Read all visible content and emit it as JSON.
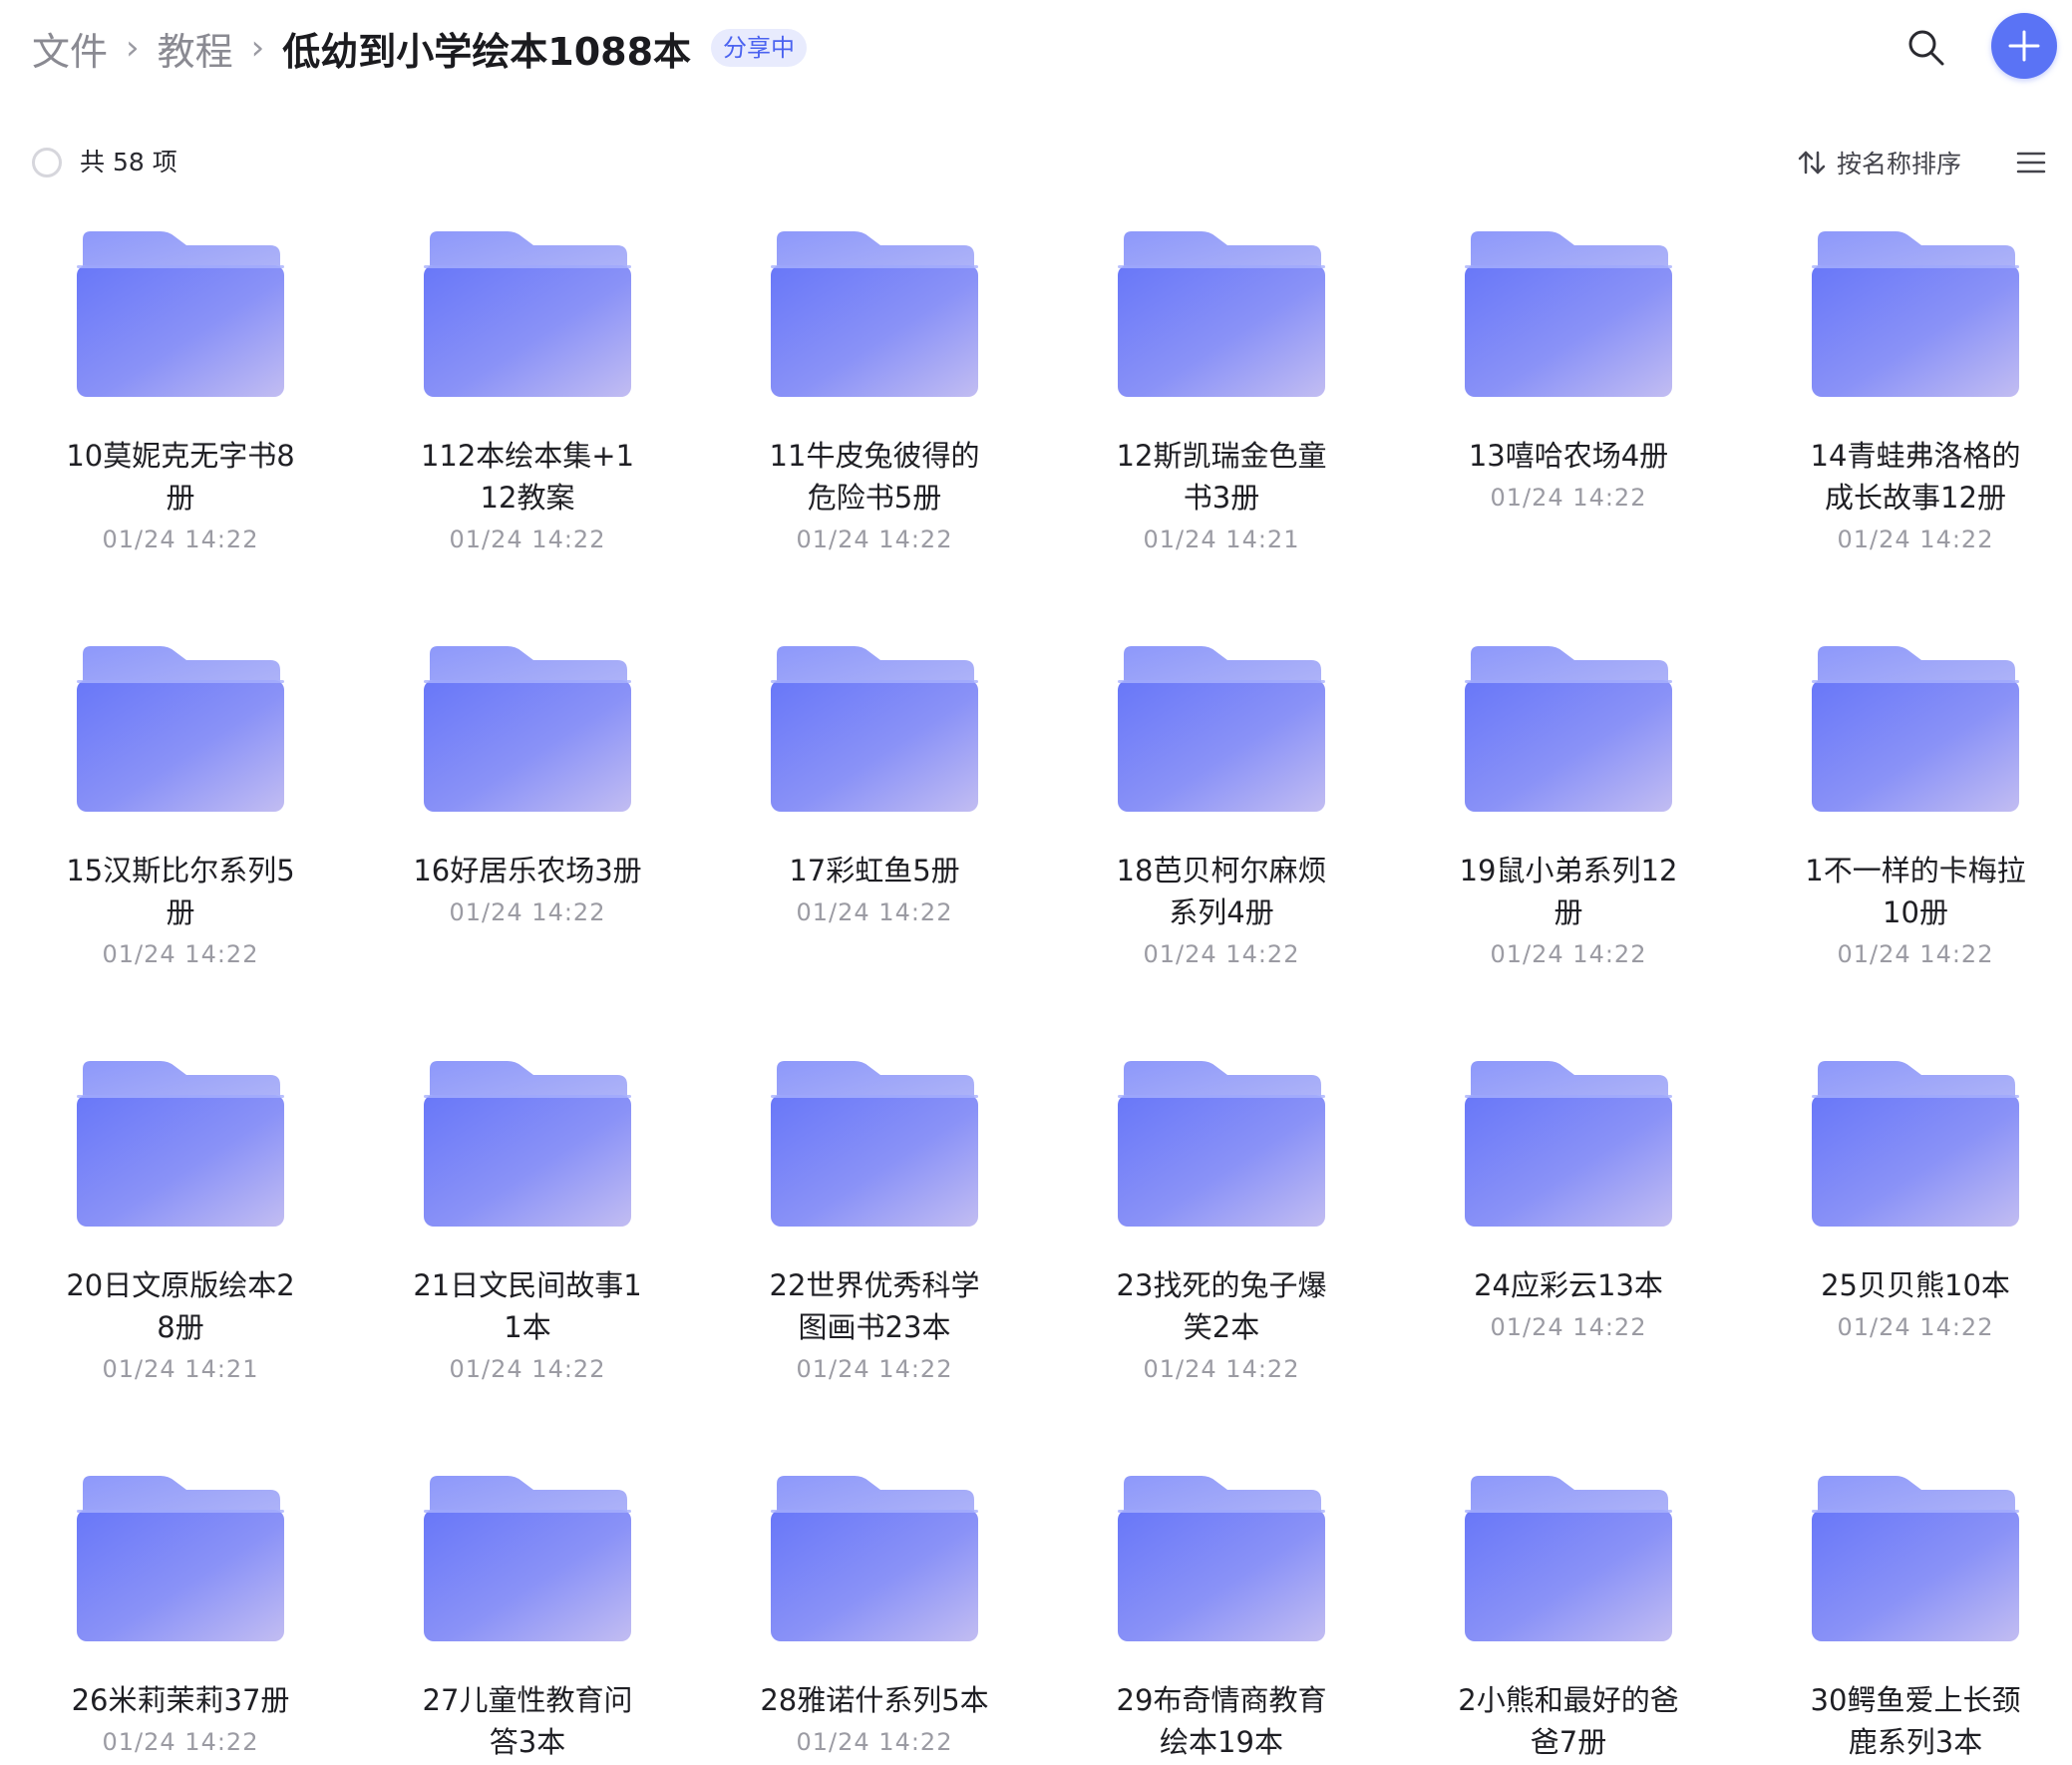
{
  "breadcrumb": {
    "root": "文件",
    "parent": "教程",
    "current": "低幼到小学绘本1088本",
    "badge": "分享中"
  },
  "toolbar": {
    "count_label": "共 58 项",
    "sort_label": "按名称排序"
  },
  "icons": {
    "search": "search-icon",
    "add": "plus-icon",
    "sort": "sort-arrows-icon",
    "list": "list-view-icon",
    "folder": "folder-icon"
  },
  "colors": {
    "accent": "#5a73f5",
    "folder_light": "#aab2fb",
    "folder_dark": "#6d7af7",
    "badge_text": "#4b63f0",
    "badge_bg": "#e8ebfd"
  },
  "items": [
    {
      "name": "10莫妮克无字书8册",
      "date": "01/24 14:22"
    },
    {
      "name": "112本绘本集+112教案",
      "date": "01/24 14:22"
    },
    {
      "name": "11牛皮兔彼得的危险书5册",
      "date": "01/24 14:22"
    },
    {
      "name": "12斯凯瑞金色童书3册",
      "date": "01/24 14:21"
    },
    {
      "name": "13嘻哈农场4册",
      "date": "01/24 14:22"
    },
    {
      "name": "14青蛙弗洛格的成长故事12册",
      "date": "01/24 14:22"
    },
    {
      "name": "15汉斯比尔系列5册",
      "date": "01/24 14:22"
    },
    {
      "name": "16好居乐农场3册",
      "date": "01/24 14:22"
    },
    {
      "name": "17彩虹鱼5册",
      "date": "01/24 14:22"
    },
    {
      "name": "18芭贝柯尔麻烦系列4册",
      "date": "01/24 14:22"
    },
    {
      "name": "19鼠小弟系列12册",
      "date": "01/24 14:22"
    },
    {
      "name": "1不一样的卡梅拉10册",
      "date": "01/24 14:22"
    },
    {
      "name": "20日文原版绘本28册",
      "date": "01/24 14:21"
    },
    {
      "name": "21日文民间故事11本",
      "date": "01/24 14:22"
    },
    {
      "name": "22世界优秀科学图画书23本",
      "date": "01/24 14:22"
    },
    {
      "name": "23找死的兔子爆笑2本",
      "date": "01/24 14:22"
    },
    {
      "name": "24应彩云13本",
      "date": "01/24 14:22"
    },
    {
      "name": "25贝贝熊10本",
      "date": "01/24 14:22"
    },
    {
      "name": "26米莉茉莉37册",
      "date": "01/24 14:22"
    },
    {
      "name": "27儿童性教育问答3本",
      "date": ""
    },
    {
      "name": "28雅诺什系列5本",
      "date": "01/24 14:22"
    },
    {
      "name": "29布奇情商教育绘本19本",
      "date": ""
    },
    {
      "name": "2小熊和最好的爸爸7册",
      "date": ""
    },
    {
      "name": "30鳄鱼爱上长颈鹿系列3本",
      "date": ""
    }
  ]
}
